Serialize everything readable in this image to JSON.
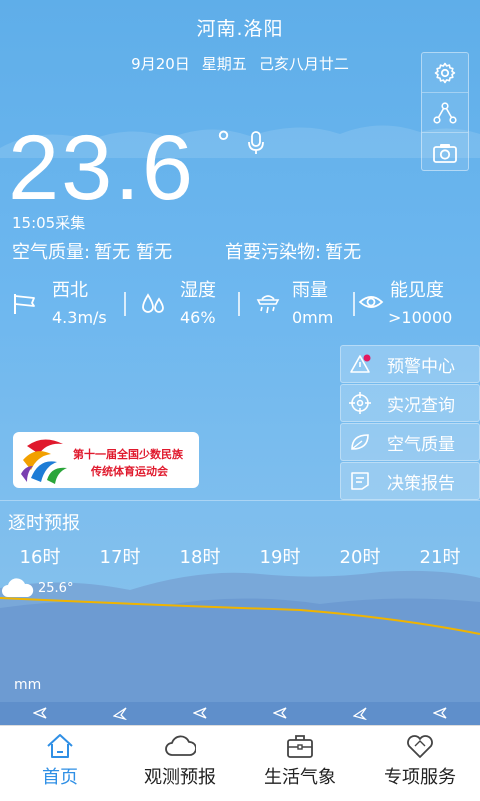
{
  "header": {
    "city": "河南.洛阳",
    "date": "9月20日",
    "weekday": "星期五",
    "lunar": "己亥八月廿二"
  },
  "current": {
    "temperature": "23.6",
    "degree_symbol": "°",
    "collect_time": "15:05采集",
    "air_quality_label": "空气质量:",
    "air_quality_value1": "暂无",
    "air_quality_value2": "暂无",
    "pollutant_label": "首要污染物:",
    "pollutant_value": "暂无"
  },
  "stats": [
    {
      "label": "西北",
      "value": "4.3m/s",
      "icon": "wind-flag-icon"
    },
    {
      "label": "湿度",
      "value": "46%",
      "icon": "humidity-drops-icon"
    },
    {
      "label": "雨量",
      "value": "0mm",
      "icon": "rain-icon"
    },
    {
      "label": "能见度",
      "value": ">10000",
      "icon": "eye-icon"
    }
  ],
  "side_buttons": [
    {
      "label": "预警中心",
      "icon": "warning-triangle-icon"
    },
    {
      "label": "实况查询",
      "icon": "crosshair-icon"
    },
    {
      "label": "空气质量",
      "icon": "leaf-icon"
    },
    {
      "label": "决策报告",
      "icon": "report-icon"
    }
  ],
  "banner": {
    "line1": "第十一届全国少数民族",
    "line2": "传统体育运动会"
  },
  "hourly": {
    "title": "逐时预报",
    "hours": [
      "16时",
      "17时",
      "18时",
      "19时",
      "20时",
      "21时"
    ],
    "first_temp": "25.6°",
    "unit_label": "mm"
  },
  "tabs": [
    {
      "label": "首页",
      "active": true,
      "icon": "home-icon"
    },
    {
      "label": "观测预报",
      "active": false,
      "icon": "cloud-icon"
    },
    {
      "label": "生活气象",
      "active": false,
      "icon": "briefcase-icon"
    },
    {
      "label": "专项服务",
      "active": false,
      "icon": "heart-icon"
    }
  ],
  "colors": {
    "accent": "#2f8fe5",
    "warning_dot": "#e4185f",
    "temp_line": "#f0b400"
  }
}
